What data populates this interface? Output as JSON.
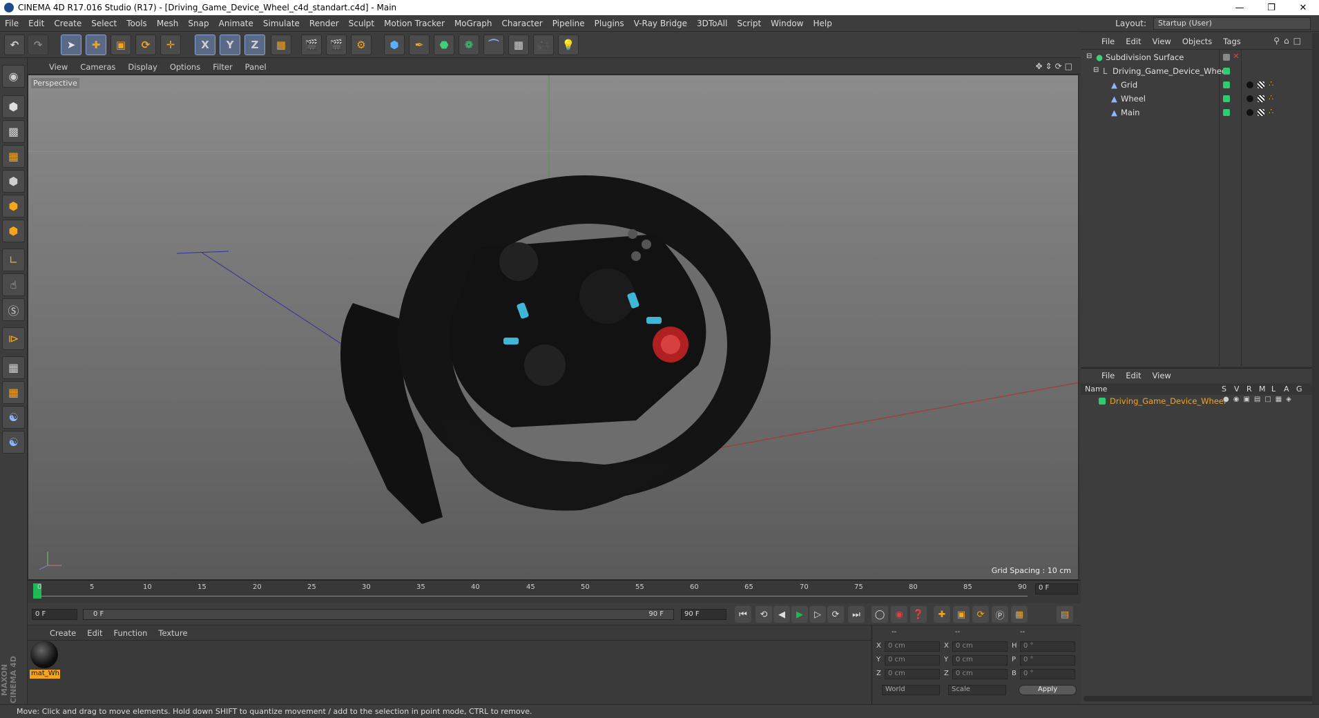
{
  "window": {
    "title": "CINEMA 4D R17.016 Studio (R17) - [Driving_Game_Device_Wheel_c4d_standart.c4d] - Main"
  },
  "menubar": {
    "items": [
      "File",
      "Edit",
      "Create",
      "Select",
      "Tools",
      "Mesh",
      "Snap",
      "Animate",
      "Simulate",
      "Render",
      "Sculpt",
      "Motion Tracker",
      "MoGraph",
      "Character",
      "Pipeline",
      "Plugins",
      "V-Ray Bridge",
      "3DToAll",
      "Script",
      "Window",
      "Help"
    ],
    "layout_label": "Layout:",
    "layout_value": "Startup (User)"
  },
  "toolbar": {
    "axis_x": "X",
    "axis_y": "Y",
    "axis_z": "Z"
  },
  "viewport": {
    "menu": [
      "View",
      "Cameras",
      "Display",
      "Options",
      "Filter",
      "Panel"
    ],
    "label": "Perspective",
    "grid_spacing": "Grid Spacing : 10 cm"
  },
  "timeline": {
    "ticks": [
      "0",
      "5",
      "10",
      "15",
      "20",
      "25",
      "30",
      "35",
      "40",
      "45",
      "50",
      "55",
      "60",
      "65",
      "70",
      "75",
      "80",
      "85",
      "90"
    ],
    "current_frame": "0 F"
  },
  "controls": {
    "start_frame": "0 F",
    "range_start": "0 F",
    "range_end": "90 F",
    "end_frame": "90 F"
  },
  "material_manager": {
    "menu": [
      "Create",
      "Edit",
      "Function",
      "Texture"
    ],
    "materials": [
      {
        "name": "mat_Wh"
      }
    ]
  },
  "coordinates": {
    "headers": [
      "--",
      "--",
      "--"
    ],
    "rows": [
      {
        "a": "X",
        "av": "0 cm",
        "b": "X",
        "bv": "0 cm",
        "c": "H",
        "cv": "0 °"
      },
      {
        "a": "Y",
        "av": "0 cm",
        "b": "Y",
        "bv": "0 cm",
        "c": "P",
        "cv": "0 °"
      },
      {
        "a": "Z",
        "av": "0 cm",
        "b": "Z",
        "bv": "0 cm",
        "c": "B",
        "cv": "0 °"
      }
    ],
    "mode1": "World",
    "mode2": "Scale",
    "apply": "Apply"
  },
  "object_manager": {
    "menu": [
      "File",
      "Edit",
      "View",
      "Objects",
      "Tags"
    ],
    "objects": [
      {
        "name": "Subdivision Surface"
      },
      {
        "name": "Driving_Game_Device_Wheel"
      },
      {
        "name": "Grid"
      },
      {
        "name": "Wheel"
      },
      {
        "name": "Main"
      }
    ]
  },
  "attribute_manager": {
    "menu": [
      "File",
      "Edit",
      "View"
    ],
    "columns": [
      "Name",
      "S",
      "V",
      "R",
      "M",
      "L",
      "A",
      "G"
    ],
    "rows": [
      {
        "name": "Driving_Game_Device_Wheel"
      }
    ]
  },
  "status": {
    "text": "Move: Click and drag to move elements. Hold down SHIFT to quantize movement / add to the selection in point mode, CTRL to remove."
  },
  "branding": {
    "text": "MAXON CINEMA 4D"
  },
  "colors": {
    "accent": "#f3a51d",
    "green_tag": "#2ecc71",
    "selected_text": "#f3a51d"
  }
}
